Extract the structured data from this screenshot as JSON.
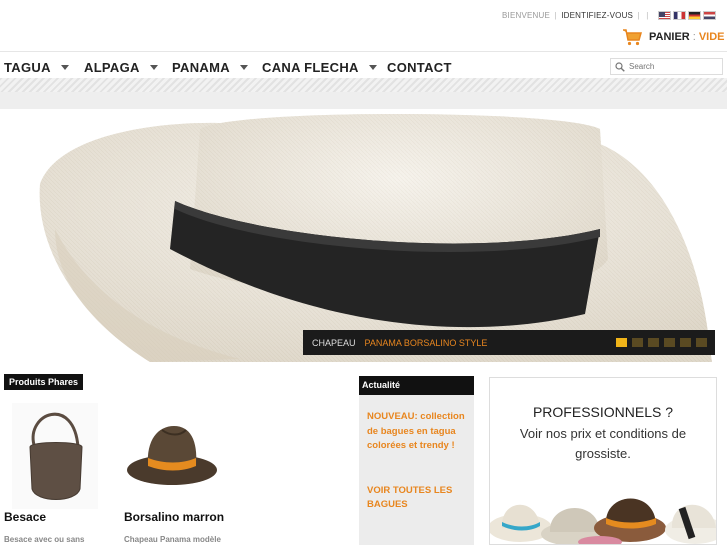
{
  "header": {
    "account": {
      "welcome": "BIENVENUE",
      "login": "IDENTIFIEZ-VOUS",
      "sep_a": "|",
      "sep_b": "|",
      "sep_c": "|"
    },
    "languages": [
      "english",
      "français",
      "deutsch",
      "nederlands"
    ],
    "cart": {
      "label": "PANIER",
      "separator": ":",
      "state": "VIDE",
      "icon": "shopping-cart-icon"
    }
  },
  "nav": {
    "items": [
      {
        "label": "TAGUA",
        "has_dropdown": true
      },
      {
        "label": "ALPAGA",
        "has_dropdown": true
      },
      {
        "label": "PANAMA",
        "has_dropdown": true
      },
      {
        "label": "CANA FLECHA",
        "has_dropdown": true
      },
      {
        "label": "CONTACT",
        "has_dropdown": false
      }
    ],
    "search_placeholder": "Search"
  },
  "slider": {
    "caption_type": "CHAPEAU",
    "caption_name": "PANAMA BORSALINO STYLE",
    "slide_count": 6,
    "active_slide": 1
  },
  "featured": {
    "label": "Produits Phares",
    "products": [
      {
        "name": "Besace",
        "desc": "Besace avec ou sans"
      },
      {
        "name": "Borsalino marron",
        "desc": "Chapeau Panama modèle"
      }
    ]
  },
  "news": {
    "label": "Actualité",
    "text": "NOUVEAU: collection de bagues en tagua colorées et trendy !",
    "link": "VOIR TOUTES LES BAGUES"
  },
  "pro": {
    "title": "PROFESSIONNELS ?",
    "subtitle": "Voir nos prix et conditions de grossiste."
  },
  "colors": {
    "accent": "#e8861f",
    "dark": "#111111",
    "dot_active": "#f0b419"
  }
}
